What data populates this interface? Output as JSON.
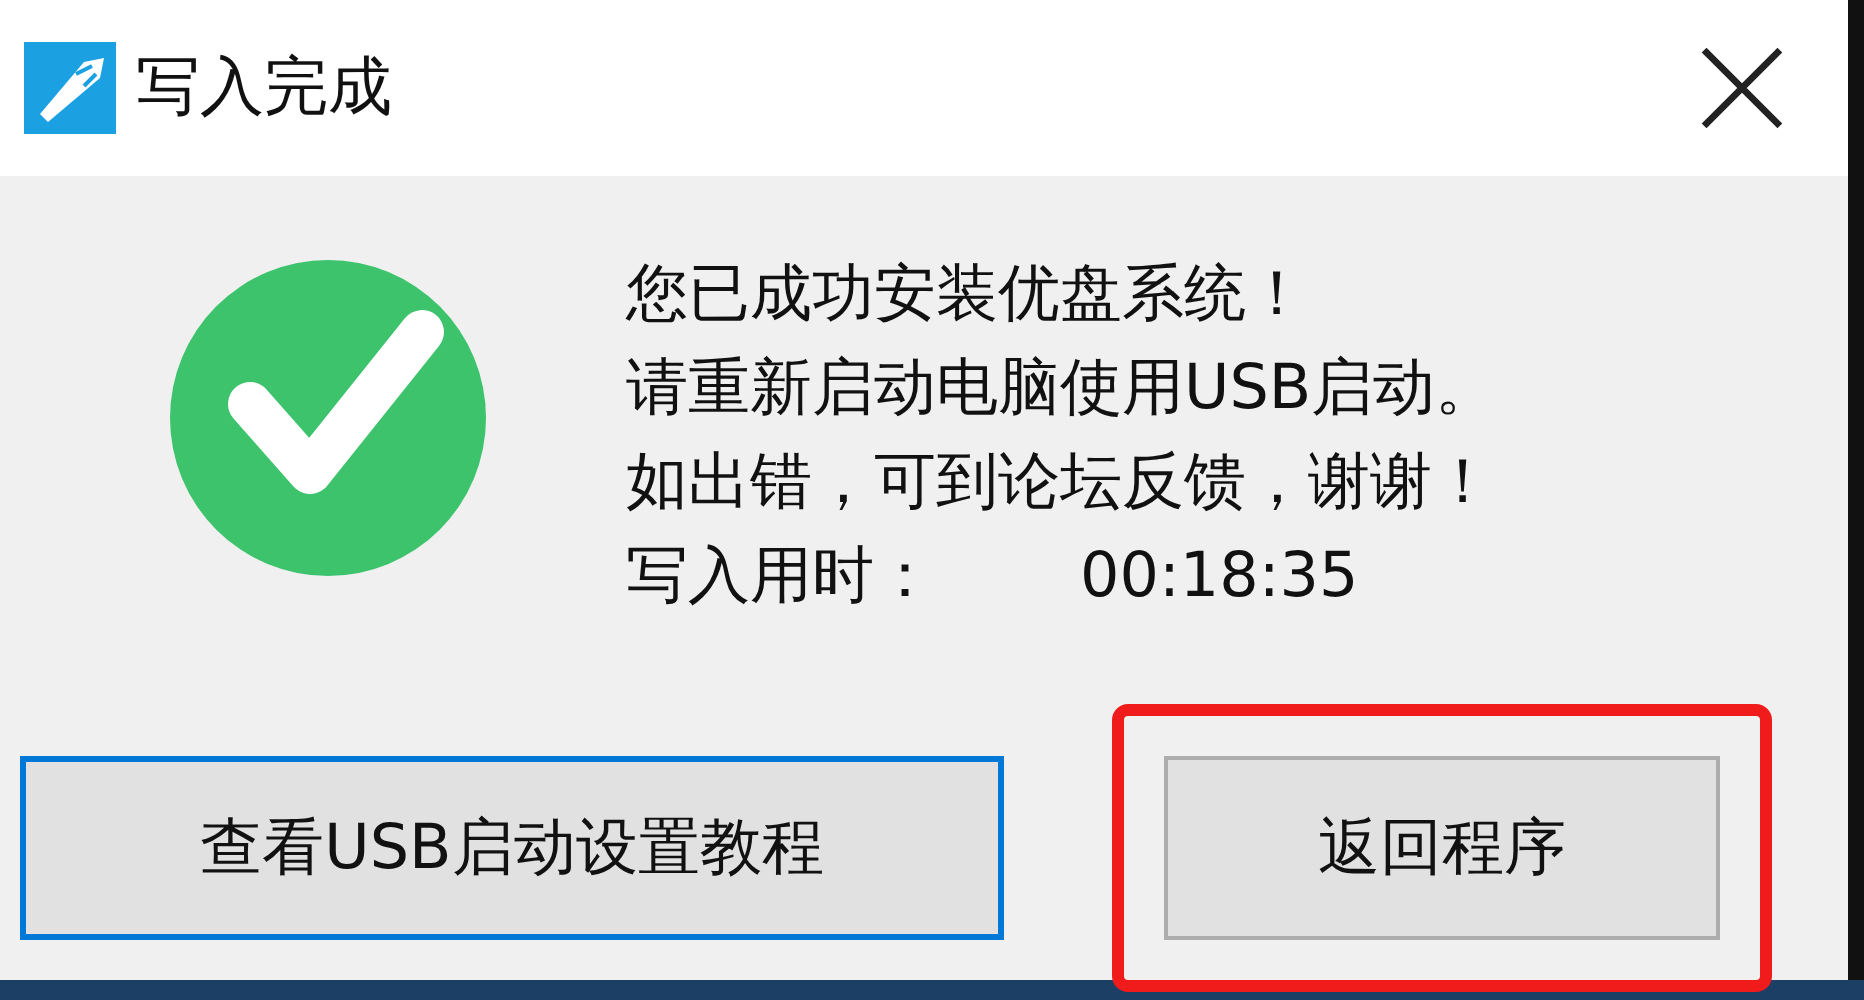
{
  "window": {
    "title": "写入完成"
  },
  "message": {
    "lines": [
      "您已成功安装优盘系统！",
      "请重新启动电脑使用USB启动。",
      "如出错，可到论坛反馈，谢谢！"
    ],
    "time_label": "写入用时：",
    "time_value": "00:18:35"
  },
  "buttons": [
    {
      "label": "查看USB启动设置教程",
      "focused": true,
      "highlighted": false
    },
    {
      "label": "返回程序",
      "focused": false,
      "highlighted": true
    }
  ]
}
